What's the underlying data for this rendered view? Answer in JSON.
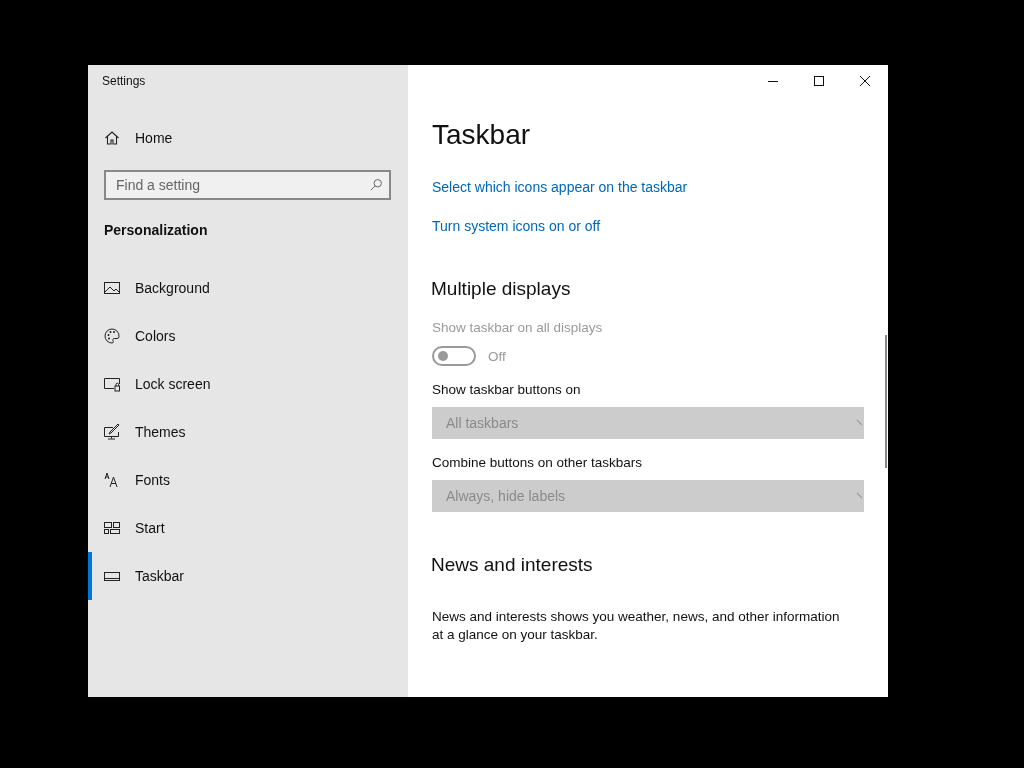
{
  "window": {
    "title": "Settings"
  },
  "sidebar": {
    "home": "Home",
    "search": {
      "placeholder": "Find a setting"
    },
    "section": "Personalization",
    "items": [
      {
        "label": "Background",
        "selected": false
      },
      {
        "label": "Colors",
        "selected": false
      },
      {
        "label": "Lock screen",
        "selected": false
      },
      {
        "label": "Themes",
        "selected": false
      },
      {
        "label": "Fonts",
        "selected": false
      },
      {
        "label": "Start",
        "selected": false
      },
      {
        "label": "Taskbar",
        "selected": true
      }
    ]
  },
  "content": {
    "title": "Taskbar",
    "links": [
      "Select which icons appear on the taskbar",
      "Turn system icons on or off"
    ],
    "sections": [
      {
        "heading": "Multiple displays",
        "settings": [
          {
            "kind": "toggle",
            "label": "Show taskbar on all displays",
            "on": false,
            "state_text": "Off",
            "disabled": true
          },
          {
            "kind": "dropdown",
            "label": "Show taskbar buttons on",
            "value": "All taskbars",
            "disabled": true
          },
          {
            "kind": "dropdown",
            "label": "Combine buttons on other taskbars",
            "value": "Always, hide labels",
            "disabled": true
          }
        ]
      },
      {
        "heading": "News and interests",
        "paragraph": "News and interests shows you weather, news, and other information at a glance on your taskbar."
      }
    ]
  }
}
